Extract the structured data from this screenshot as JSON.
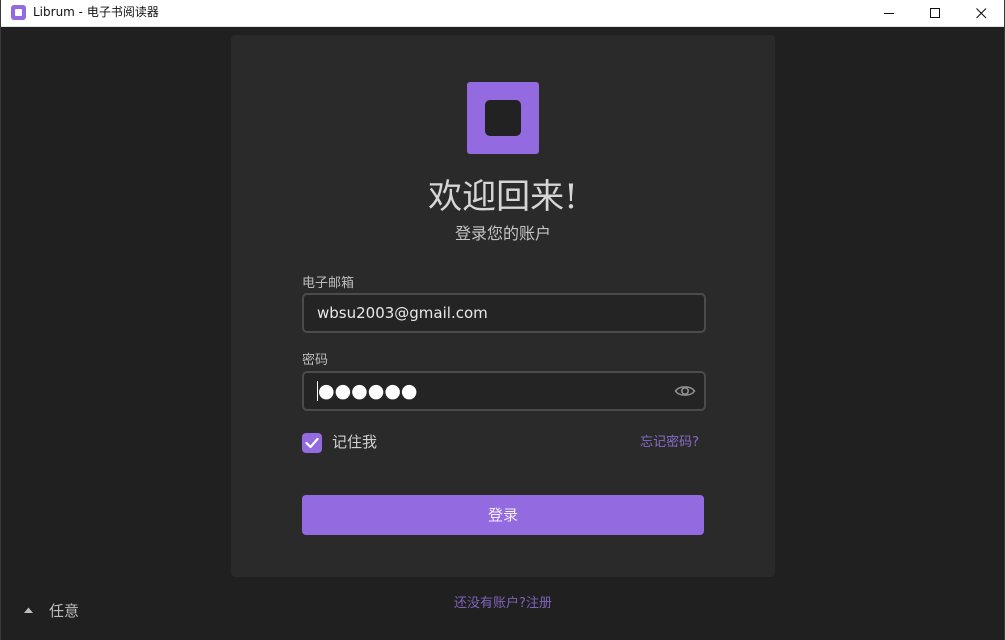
{
  "window": {
    "title": "Librum - 电子书阅读器"
  },
  "login": {
    "heading": "欢迎回来!",
    "subheading": "登录您的账户",
    "email_label": "电子邮箱",
    "email_value": "wbsu2003@gmail.com",
    "password_label": "密码",
    "password_masked": "●●●●●●",
    "remember_label": "记住我",
    "remember_checked": true,
    "forgot_label": "忘记密码?",
    "submit_label": "登录",
    "register_prompt": "还没有账户?注册"
  },
  "language": {
    "label": "任意"
  },
  "colors": {
    "accent": "#946ae0",
    "card": "#2a2a2a",
    "background": "#202020",
    "link": "#8a6ac8"
  }
}
